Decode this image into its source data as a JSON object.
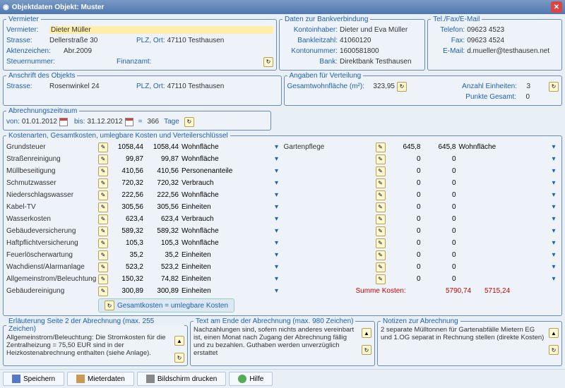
{
  "window": {
    "title": "Objektdaten  Objekt: Muster"
  },
  "landlord": {
    "legend": "Vermieter",
    "nameLabel": "Vermieter:",
    "name": "Dieter Müller",
    "streetLabel": "Strasse:",
    "street": "Dellerstraße 30",
    "plzLabel": "PLZ, Ort:",
    "plz": "47110 Testhausen",
    "fileLabel": "Aktenzeichen:",
    "file": "Abr.2009",
    "taxLabel": "Steuernummer:",
    "finLabel": "Finanzamt:"
  },
  "bank": {
    "legend": "Daten zur Bankverbindung",
    "ownerLabel": "Kontoinhaber:",
    "owner": "Dieter und Eva Müller",
    "blzLabel": "Bankleitzahl:",
    "blz": "41060120",
    "accLabel": "Kontonummer:",
    "acc": "1600581800",
    "bankLabel": "Bank:",
    "bankName": "Direktbank Testhausen"
  },
  "contact": {
    "legend": "Tel./Fax/E-Mail",
    "telLabel": "Telefon:",
    "tel": "09623 4523",
    "faxLabel": "Fax:",
    "fax": "09623 4524",
    "mailLabel": "E-Mail:",
    "mail": "d.mueller@testhausen.net"
  },
  "objAddr": {
    "legend": "Anschrift des Objekts",
    "streetLabel": "Strasse:",
    "street": "Rosenwinkel 24",
    "plzLabel": "PLZ, Ort:",
    "plz": "47110 Testhausen"
  },
  "dist": {
    "legend": "Angaben für Verteilung",
    "areaLabel": "Gesamtwohnfläche (m²):",
    "area": "323,95",
    "unitsLabel": "Anzahl Einheiten:",
    "units": "3",
    "pointsLabel": "Punkte Gesamt:",
    "points": "0"
  },
  "period": {
    "legend": "Abrechnungszeitraum",
    "fromLabel": "von:",
    "from": "01.01.2012",
    "toLabel": "bis:",
    "to": "31.12.2012",
    "eq": "=",
    "days": "366",
    "daysLabel": "Tage"
  },
  "costs": {
    "legend": "Kostenarten, Gesamtkosten, umlegbare Kosten und Verteilerschlüssel",
    "left": [
      {
        "name": "Grundsteuer",
        "v1": "1058,44",
        "v2": "1058,44",
        "key": "Wohnfläche"
      },
      {
        "name": "Straßenreinigung",
        "v1": "99,87",
        "v2": "99,87",
        "key": "Wohnfläche"
      },
      {
        "name": "Müllbeseitigung",
        "v1": "410,56",
        "v2": "410,56",
        "key": "Personenanteile"
      },
      {
        "name": "Schmutzwasser",
        "v1": "720,32",
        "v2": "720,32",
        "key": "Verbrauch"
      },
      {
        "name": "Niederschlagswasser",
        "v1": "222,56",
        "v2": "222,56",
        "key": "Wohnfläche"
      },
      {
        "name": "Kabel-TV",
        "v1": "305,56",
        "v2": "305,56",
        "key": "Einheiten"
      },
      {
        "name": "Wasserkosten",
        "v1": "623,4",
        "v2": "623,4",
        "key": "Verbrauch"
      },
      {
        "name": "Gebäudeversicherung",
        "v1": "589,32",
        "v2": "589,32",
        "key": "Wohnfläche"
      },
      {
        "name": "Haftpflichtversicherung",
        "v1": "105,3",
        "v2": "105,3",
        "key": "Wohnfläche"
      },
      {
        "name": "Feuerlöscherwartung",
        "v1": "35,2",
        "v2": "35,2",
        "key": "Einheiten"
      },
      {
        "name": "Wachdienst/Alarmanlage",
        "v1": "523,2",
        "v2": "523,2",
        "key": "Einheiten"
      },
      {
        "name": "Allgemeinstrom/Beleuchtung",
        "v1": "150,32",
        "v2": "74,82",
        "key": "Einheiten"
      },
      {
        "name": "Gebäudereinigung",
        "v1": "300,89",
        "v2": "300,89",
        "key": "Einheiten"
      }
    ],
    "right": [
      {
        "name": "Gartenpflege",
        "v1": "645,8",
        "v2": "645,8",
        "key": "Wohnfläche"
      },
      {
        "name": "",
        "v1": "0",
        "v2": "0",
        "key": ""
      },
      {
        "name": "",
        "v1": "0",
        "v2": "0",
        "key": ""
      },
      {
        "name": "",
        "v1": "0",
        "v2": "0",
        "key": ""
      },
      {
        "name": "",
        "v1": "0",
        "v2": "0",
        "key": ""
      },
      {
        "name": "",
        "v1": "0",
        "v2": "0",
        "key": ""
      },
      {
        "name": "",
        "v1": "0",
        "v2": "0",
        "key": ""
      },
      {
        "name": "",
        "v1": "0",
        "v2": "0",
        "key": ""
      },
      {
        "name": "",
        "v1": "0",
        "v2": "0",
        "key": ""
      },
      {
        "name": "",
        "v1": "0",
        "v2": "0",
        "key": ""
      },
      {
        "name": "",
        "v1": "0",
        "v2": "0",
        "key": ""
      },
      {
        "name": "",
        "v1": "0",
        "v2": "0",
        "key": ""
      }
    ],
    "totalBtn": "Gesamtkosten = umlegbare Kosten",
    "sumLabel": "Summe Kosten:",
    "sum1": "5790,74",
    "sum2": "5715,24"
  },
  "notes": {
    "n1": {
      "legend": "Erläuterung Seite 2 der Abrechnung (max. 255 Zeichen)",
      "text": "Allgemeinstrom/Beleuchtung: Die Stromkosten für die Zentralheizung = 75,50 EUR sind in der Heizkostenabrechnung enthalten (siehe Anlage)."
    },
    "n2": {
      "legend": "Text am Ende der Abrechnung (max. 980 Zeichen)",
      "text": "Nachzahlungen sind, sofern nichts anderes vereinbart ist, einen Monat nach Zugang der Abrechnung fällig und zu bezahlen. Guthaben werden unverzüglich erstattet"
    },
    "n3": {
      "legend": "Notizen zur Abrechnung",
      "text": "2 separate Mülltonnen für Gartenabfälle Mietern EG und 1.OG separat in Rechnung stellen (direkte Kosten)"
    }
  },
  "toolbar": {
    "save": "Speichern",
    "tenant": "Mieterdaten",
    "print": "Bildschirm drucken",
    "help": "Hilfe"
  }
}
